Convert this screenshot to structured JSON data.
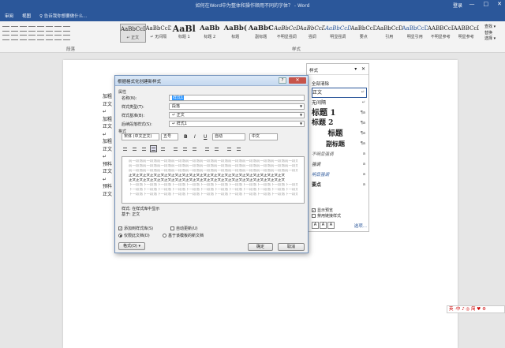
{
  "window": {
    "title": "如何在Word中为整体和操作顺用不同的字体？ - Word",
    "login": "登录",
    "controls": [
      "—",
      "□",
      "✕"
    ]
  },
  "ribbon": {
    "tabs": [
      "审阅",
      "视图"
    ],
    "active_tab": "视图",
    "tell_me": "♀ 告诉我你想要做什么...",
    "groups": {
      "paragraph": "段落",
      "styles": "样式"
    },
    "gallery": [
      {
        "sample": "AaBbCcDc",
        "name": "↵ 正文"
      },
      {
        "sample": "AaBbCcDc",
        "name": "↵ 无间隔"
      },
      {
        "sample": "AaBl",
        "name": "标题 1"
      },
      {
        "sample": "AaBb",
        "name": "标题 2"
      },
      {
        "sample": "AaBb(",
        "name": "标题"
      },
      {
        "sample": "AaBbC",
        "name": "副标题"
      },
      {
        "sample": "AaBbCcDi",
        "name": "不明显强调"
      },
      {
        "sample": "AaBbCcDi",
        "name": "强调"
      },
      {
        "sample": "AaBbCcDi",
        "name": "明显强调"
      },
      {
        "sample": "AaBbCcDc",
        "name": "要点"
      },
      {
        "sample": "AaBbCcDc",
        "name": "引用"
      },
      {
        "sample": "AaBbCcDc",
        "name": "明显引用"
      },
      {
        "sample": "AABBCcDi",
        "name": "不明显参考"
      },
      {
        "sample": "AABBCcDi",
        "name": "明显参考"
      }
    ],
    "right_items": [
      "查找 ▾",
      "替换",
      "选择 ▾"
    ]
  },
  "doc": {
    "lines": [
      "加粗",
      "正文",
      "↵",
      "加粗",
      "正文",
      "↵",
      "加粗",
      "正文",
      "↵",
      "预料",
      "正文",
      "↵",
      "预料",
      "正文"
    ]
  },
  "styles_pane": {
    "title": "样式",
    "controls": [
      "▾",
      "✕"
    ],
    "clear_all": "全部清除",
    "items": [
      {
        "label": "正文",
        "mark": "↵",
        "selected": true
      },
      {
        "label": "无间隔",
        "mark": "↵"
      },
      {
        "label": "标题 1",
        "mark": "¶a"
      },
      {
        "label": "标题 2",
        "mark": "¶a"
      },
      {
        "label": "标题",
        "mark": "¶a"
      },
      {
        "label": "副标题",
        "mark": "¶a"
      },
      {
        "label": "不明显强调",
        "mark": "a"
      },
      {
        "label": "强调",
        "mark": "a"
      },
      {
        "label": "明显强调",
        "mark": "a"
      },
      {
        "label": "要点",
        "mark": "a"
      }
    ],
    "show_preview": "显示预览",
    "disable_linked": "禁用链接样式",
    "options_link": "选项..."
  },
  "dialog": {
    "title": "根据格式化创建新样式",
    "help": "?",
    "close": "✕",
    "section_props": "属性",
    "name_label": "名称(N):",
    "name_value": "样式1",
    "type_label": "样式类型(T):",
    "type_value": "段落",
    "based_label": "样式基准(B):",
    "based_value": "↵ 正文",
    "next_label": "后续段落样式(S):",
    "next_value": "↵ 样式1",
    "section_format": "格式",
    "font": "宋体 (中文正文)",
    "size": "五号",
    "bold": "B",
    "italic": "I",
    "underline": "U",
    "color": "自动",
    "lang": "中文",
    "preview_before": "前一段落前一段落前一段落前一段落前一段落前一段落前一段落前一段落前一段落前一段落前一段落前一段落前一段落前一段落前一段落前一段落",
    "preview_sample": "正文正文正文正文正文正文正文正文正文正文正文正文正文正文正文正文正文正文正文正文正文正文",
    "preview_after": "下一段落下一段落下一段落下一段落下一段落下一段落下一段落下一段落下一段落下一段落下一段落下一段落下一段落下一段落下一段落下一段落",
    "desc_line1": "样式: 在样式库中显示",
    "desc_line2": "基于: 正文",
    "add_to_gallery": "添加到样式库(S)",
    "auto_update": "自动更新(U)",
    "only_this_doc": "仅限此文档(D)",
    "new_docs": "基于该模板的新文档",
    "format_button": "格式(O) ▾",
    "ok": "确定",
    "cancel": "取消"
  },
  "tray": {
    "text": "英 ·中 ♪ ◎ 简 ♥ ⚙"
  },
  "colors": {
    "accent": "#2b579a",
    "selection": "#3399ff",
    "close_red": "#c7544a"
  }
}
